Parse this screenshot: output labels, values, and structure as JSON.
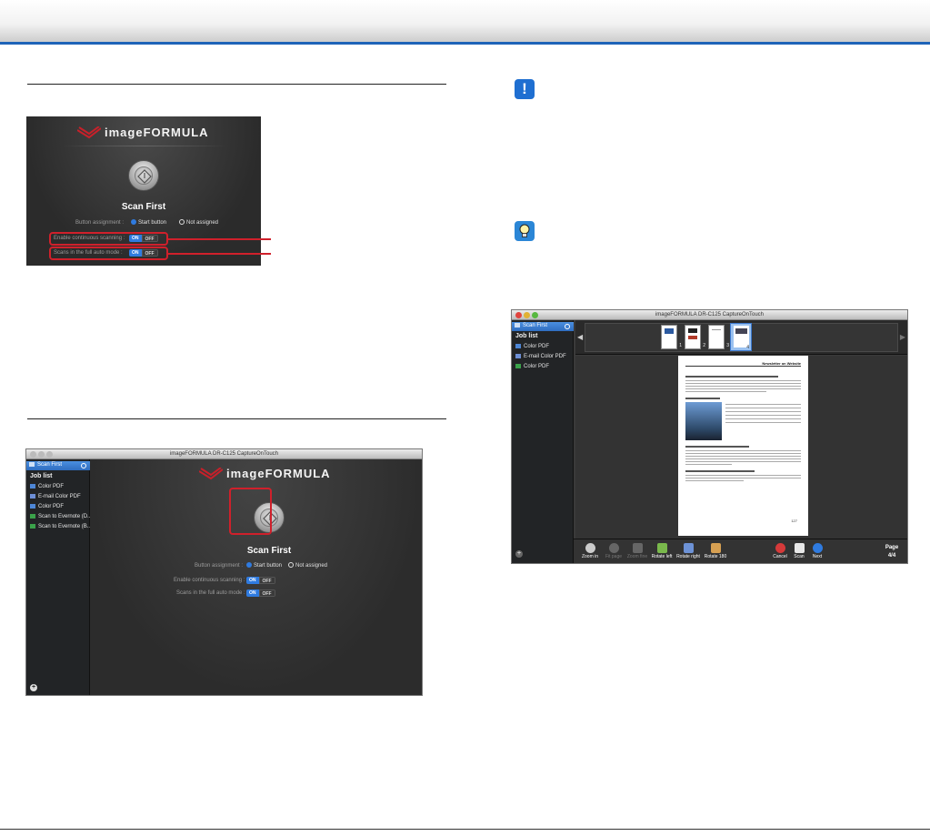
{
  "shot1": {
    "logo": "imageFORMULA",
    "scan_title": "Scan First",
    "assign_label": "Button assignment :",
    "assign_opt1": "Start button",
    "assign_opt2": "Not assigned",
    "cont_label": "Enable continuous scanning :",
    "auto_label": "Scans in the full auto mode :",
    "on": "ON",
    "off": "OFF"
  },
  "shot2": {
    "window_title": "imageFORMULA DR-C125 CaptureOnTouch",
    "sidebar_selected": "Scan First",
    "job_list": "Job list",
    "jobs": [
      "Color PDF",
      "E-mail Color PDF",
      "Color PDF",
      "Scan to Evernote (D...",
      "Scan to Evernote (B..."
    ],
    "logo": "imageFORMULA",
    "scan_title": "Scan First",
    "assign_label": "Button assignment :",
    "assign_opt1": "Start button",
    "assign_opt2": "Not assigned",
    "cont_label": "Enable continuous scanning :",
    "auto_label": "Scans in the full auto mode :",
    "on": "ON",
    "off": "OFF"
  },
  "shot3": {
    "window_title": "imageFORMULA DR-C125 CaptureOnTouch",
    "sidebar_selected": "Scan First",
    "job_list": "Job list",
    "jobs": [
      "Color PDF",
      "E-mail Color PDF",
      "Color PDF"
    ],
    "thumbs": [
      "1",
      "2",
      "3",
      "4"
    ],
    "toolbar": [
      "Zoom in",
      "Fit page",
      "Zoom fine",
      "Rotate left",
      "Rotate right",
      "Rotate 180",
      "Cancel",
      "Scan",
      "Next"
    ],
    "page_label": "Page",
    "page_value": "4/4",
    "doc_header": "Newsletter on Website",
    "doc_page_no": "127"
  },
  "colors": {
    "accent_blue": "#1e63b8",
    "highlight_red": "#d0202b",
    "toggle_on": "#2f7be0"
  },
  "icons": {
    "important": "exclamation-icon",
    "hint": "lightbulb-icon"
  }
}
